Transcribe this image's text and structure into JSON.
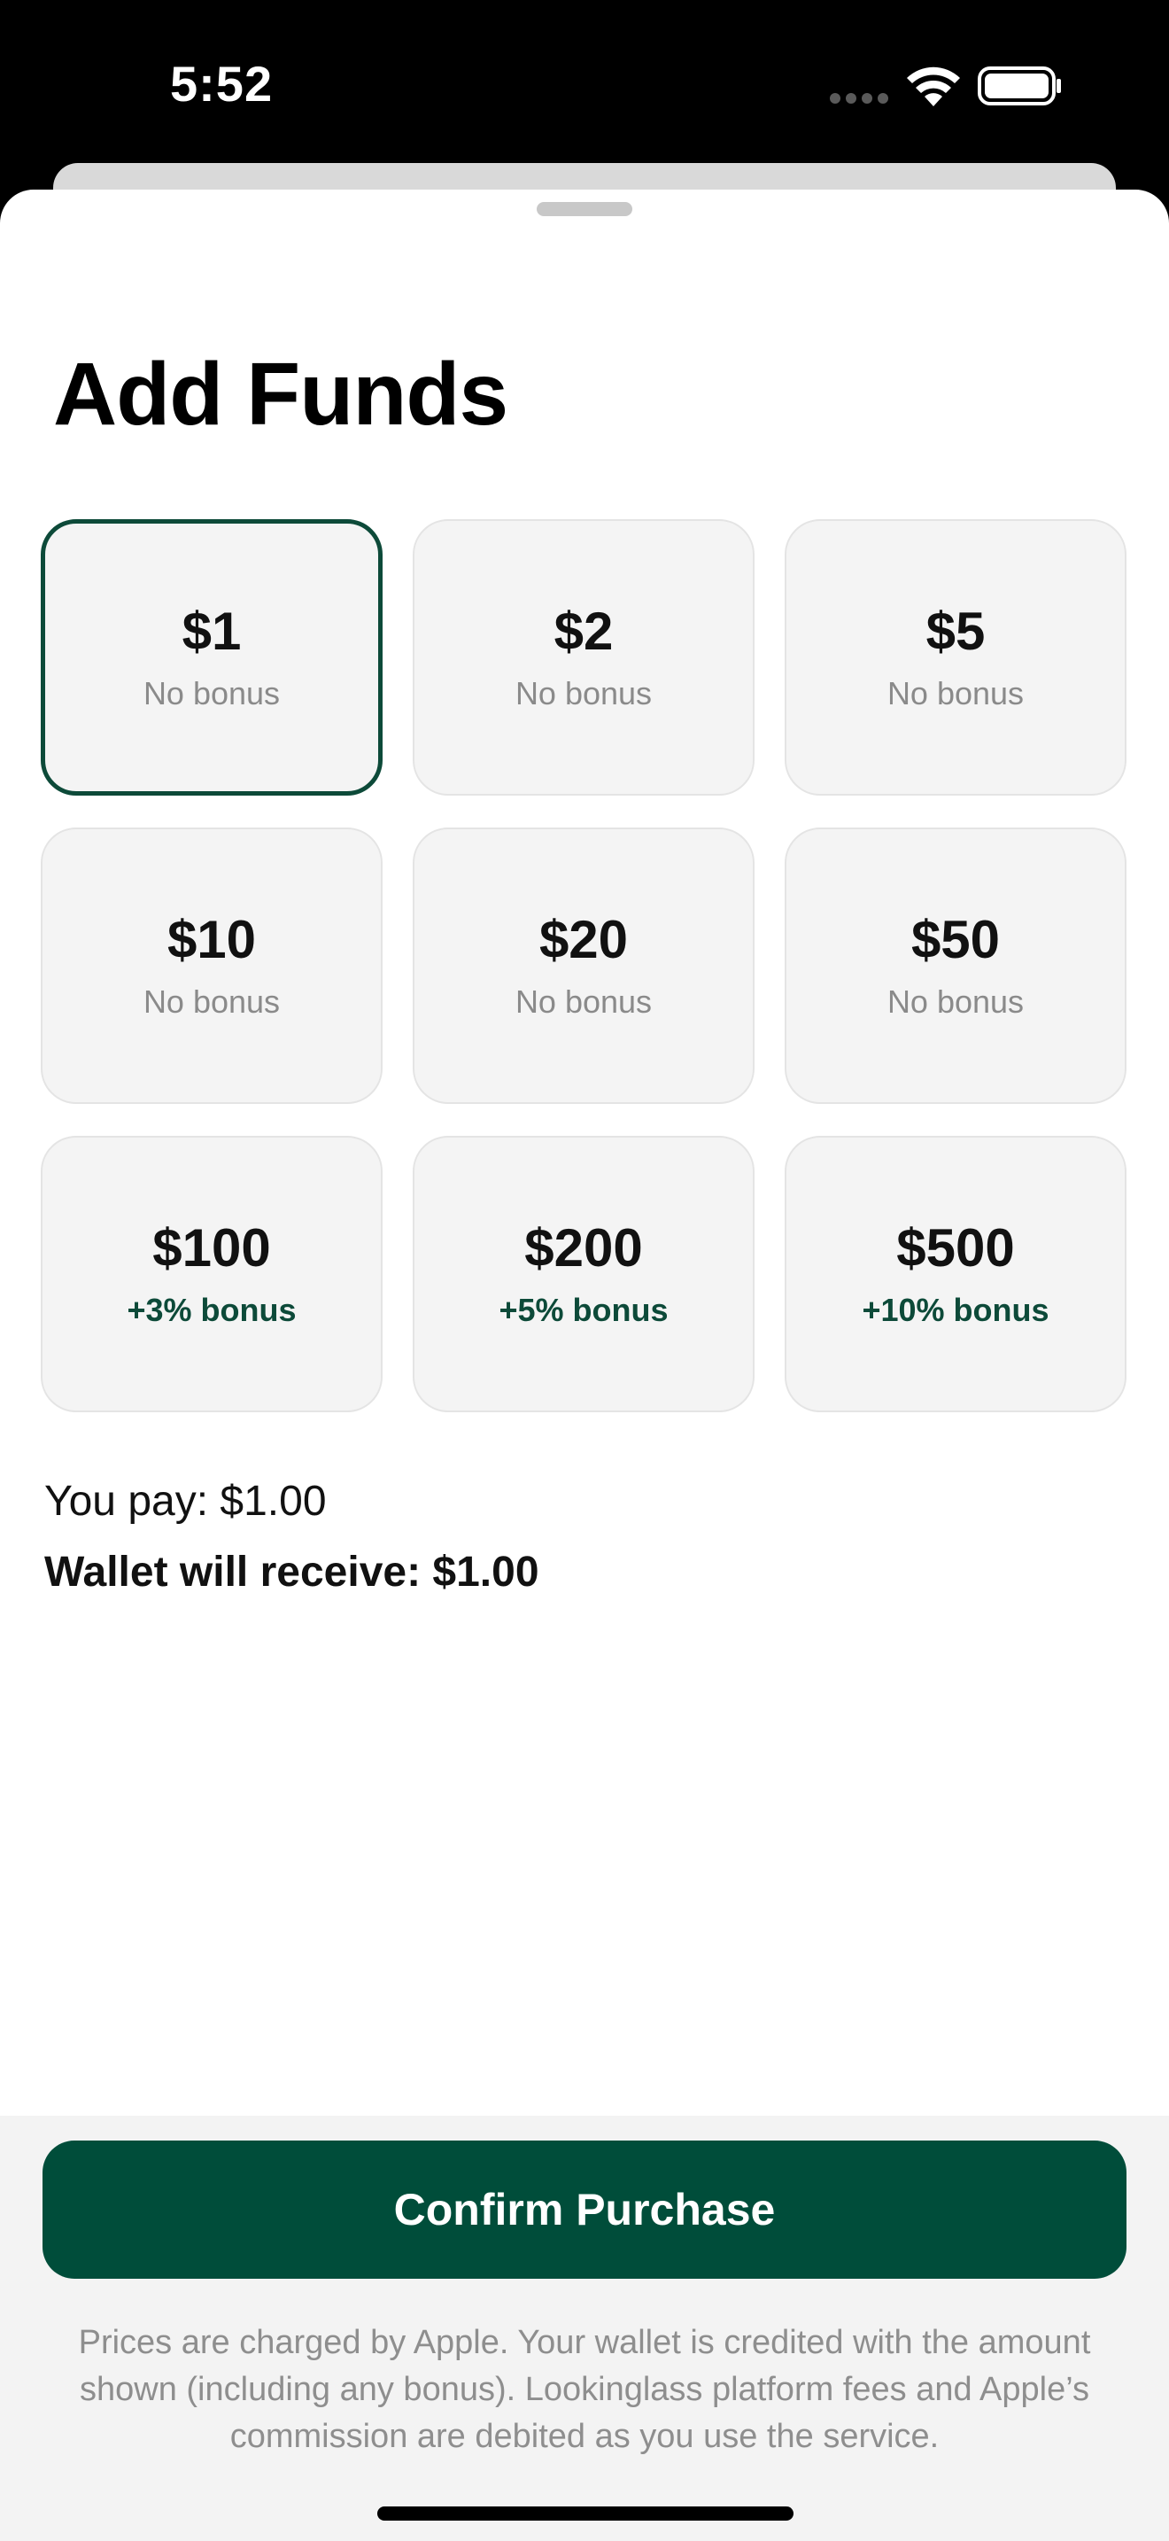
{
  "status_bar": {
    "time": "5:52"
  },
  "sheet": {
    "title": "Add Funds"
  },
  "amounts": [
    {
      "value": "$1",
      "bonus": "No bonus",
      "has_bonus": false,
      "selected": true
    },
    {
      "value": "$2",
      "bonus": "No bonus",
      "has_bonus": false,
      "selected": false
    },
    {
      "value": "$5",
      "bonus": "No bonus",
      "has_bonus": false,
      "selected": false
    },
    {
      "value": "$10",
      "bonus": "No bonus",
      "has_bonus": false,
      "selected": false
    },
    {
      "value": "$20",
      "bonus": "No bonus",
      "has_bonus": false,
      "selected": false
    },
    {
      "value": "$50",
      "bonus": "No bonus",
      "has_bonus": false,
      "selected": false
    },
    {
      "value": "$100",
      "bonus": "+3% bonus",
      "has_bonus": true,
      "selected": false
    },
    {
      "value": "$200",
      "bonus": "+5% bonus",
      "has_bonus": true,
      "selected": false
    },
    {
      "value": "$500",
      "bonus": "+10% bonus",
      "has_bonus": true,
      "selected": false
    }
  ],
  "summary": {
    "pay": "You pay: $1.00",
    "receive": "Wallet will receive: $1.00"
  },
  "footer": {
    "confirm_label": "Confirm Purchase",
    "disclaimer": "Prices are charged by Apple. Your wallet is credited with the amount shown (including any bonus). Lookinglass platform fees and Apple’s commission are debited as you use the service."
  },
  "colors": {
    "accent": "#004d3a",
    "bonus_text": "#0d4a39",
    "card_bg": "#f4f4f4"
  },
  "icons": {
    "signal": "cellular-signal-icon",
    "wifi": "wifi-icon",
    "battery": "battery-icon"
  }
}
